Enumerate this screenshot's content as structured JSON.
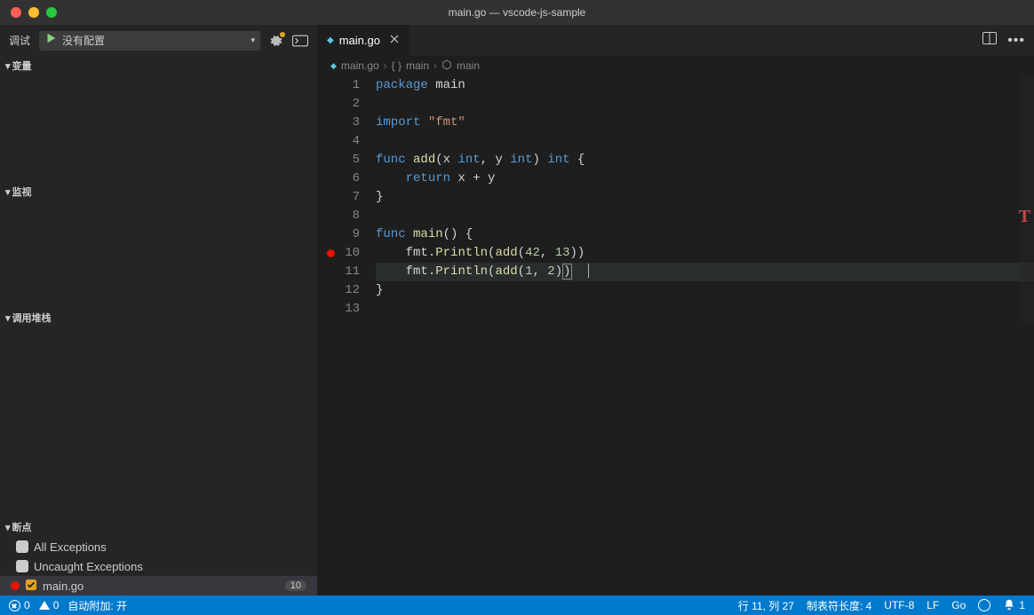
{
  "window": {
    "title": "main.go — vscode-js-sample"
  },
  "sidebar": {
    "debug_label": "调试",
    "config_select": "没有配置",
    "sections": {
      "variables": "变量",
      "watch": "监视",
      "callstack": "调用堆栈",
      "breakpoints": "断点"
    },
    "breakpoints": {
      "all_exceptions": "All Exceptions",
      "uncaught_exceptions": "Uncaught Exceptions",
      "file_name": "main.go",
      "file_line": "10"
    }
  },
  "editor": {
    "tab": {
      "name": "main.go"
    },
    "breadcrumb": {
      "file": "main.go",
      "scope": "main",
      "symbol": "main"
    },
    "code": {
      "lines": [
        {
          "n": 1,
          "tokens": [
            [
              "kw",
              "package"
            ],
            [
              "ident",
              " main"
            ]
          ]
        },
        {
          "n": 2,
          "tokens": []
        },
        {
          "n": 3,
          "tokens": [
            [
              "kw",
              "import"
            ],
            [
              "punc",
              " "
            ],
            [
              "str",
              "\"fmt\""
            ]
          ]
        },
        {
          "n": 4,
          "tokens": []
        },
        {
          "n": 5,
          "tokens": [
            [
              "kw",
              "func"
            ],
            [
              "punc",
              " "
            ],
            [
              "fn",
              "add"
            ],
            [
              "punc",
              "(x "
            ],
            [
              "tp",
              "int"
            ],
            [
              "punc",
              ", y "
            ],
            [
              "tp",
              "int"
            ],
            [
              "punc",
              ") "
            ],
            [
              "tp",
              "int"
            ],
            [
              "punc",
              " {"
            ]
          ]
        },
        {
          "n": 6,
          "tokens": [
            [
              "punc",
              "    "
            ],
            [
              "kw",
              "return"
            ],
            [
              "ident",
              " x + y"
            ]
          ]
        },
        {
          "n": 7,
          "tokens": [
            [
              "punc",
              "}"
            ]
          ]
        },
        {
          "n": 8,
          "tokens": []
        },
        {
          "n": 9,
          "tokens": [
            [
              "kw",
              "func"
            ],
            [
              "punc",
              " "
            ],
            [
              "fn",
              "main"
            ],
            [
              "punc",
              "() {"
            ]
          ]
        },
        {
          "n": 10,
          "bp": true,
          "tokens": [
            [
              "punc",
              "    "
            ],
            [
              "pkg",
              "fmt"
            ],
            [
              "punc",
              "."
            ],
            [
              "fn",
              "Println"
            ],
            [
              "punc",
              "("
            ],
            [
              "fn",
              "add"
            ],
            [
              "punc",
              "("
            ],
            [
              "num",
              "42"
            ],
            [
              "punc",
              ", "
            ],
            [
              "num",
              "13"
            ],
            [
              "punc",
              "))"
            ]
          ]
        },
        {
          "n": 11,
          "hl": true,
          "cursor": true,
          "tokens": [
            [
              "punc",
              "    "
            ],
            [
              "pkg",
              "fmt"
            ],
            [
              "punc",
              "."
            ],
            [
              "fn",
              "Println"
            ],
            [
              "punc",
              "("
            ],
            [
              "fn",
              "add"
            ],
            [
              "punc",
              "("
            ],
            [
              "num",
              "1"
            ],
            [
              "punc",
              ", "
            ],
            [
              "num",
              "2"
            ],
            [
              "punc",
              ")"
            ],
            [
              "punc bracket-match",
              ")"
            ]
          ]
        },
        {
          "n": 12,
          "tokens": [
            [
              "punc",
              "}"
            ]
          ]
        },
        {
          "n": 13,
          "tokens": []
        }
      ]
    }
  },
  "statusbar": {
    "errors": "0",
    "warnings": "0",
    "auto_attach": "自动附加: 开",
    "cursor": "行 11, 列 27",
    "tab_size": "制表符长度: 4",
    "encoding": "UTF-8",
    "eol": "LF",
    "lang": "Go",
    "notifications": "1"
  }
}
